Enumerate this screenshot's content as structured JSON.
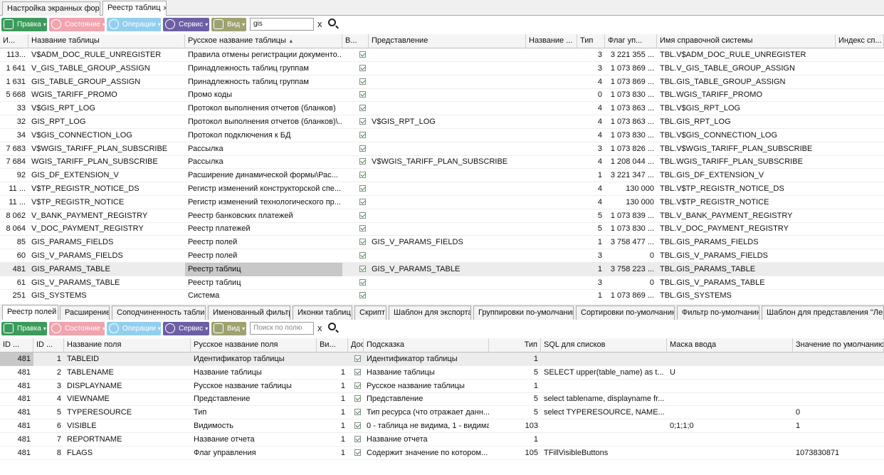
{
  "doc_tabs": [
    {
      "label": "Настройка экранных форм"
    },
    {
      "label": "Реестр таблиц",
      "close": "x"
    }
  ],
  "toolbar1": {
    "edit": "Правка",
    "state": "Состояние",
    "ops": "Операции",
    "service": "Сервис",
    "view": "Вид",
    "search_value": "gis",
    "clear": "x"
  },
  "top_grid": {
    "columns": [
      "И...",
      "Название таблицы",
      "Русское название таблицы",
      "В...",
      "Представление",
      "Название ...",
      "Тип",
      "Флаг уп...",
      "Имя справочной системы",
      "Индекс сп..."
    ],
    "rows": [
      {
        "id": "113...",
        "name": "V$ADM_DOC_RULE_UNREGISTER",
        "rus": "Правила отмены регистрации документо...",
        "view": "",
        "type": "3",
        "flag": "3 221 355 ...",
        "ref": "TBL.V$ADM_DOC_RULE_UNREGISTER"
      },
      {
        "id": "1 641",
        "name": "V_GIS_TABLE_GROUP_ASSIGN",
        "rus": "Принадлежность таблиц группам",
        "view": "",
        "type": "3",
        "flag": "1 073 869 ...",
        "ref": "TBL.V_GIS_TABLE_GROUP_ASSIGN"
      },
      {
        "id": "1 631",
        "name": "GIS_TABLE_GROUP_ASSIGN",
        "rus": "Принадлежность таблиц группам",
        "view": "",
        "type": "4",
        "flag": "1 073 869 ...",
        "ref": "TBL.GIS_TABLE_GROUP_ASSIGN"
      },
      {
        "id": "5 668",
        "name": "WGIS_TARIFF_PROMO",
        "rus": "Промо коды",
        "view": "",
        "type": "0",
        "flag": "1 073 830 ...",
        "ref": "TBL.WGIS_TARIFF_PROMO"
      },
      {
        "id": "33",
        "name": "V$GIS_RPT_LOG",
        "rus": "Протокол выполнения отчетов (бланков)",
        "view": "",
        "type": "4",
        "flag": "1 073 863 ...",
        "ref": "TBL.V$GIS_RPT_LOG"
      },
      {
        "id": "32",
        "name": "GIS_RPT_LOG",
        "rus": "Протокол выполнения отчетов (бланков)\\...",
        "view": "V$GIS_RPT_LOG",
        "type": "4",
        "flag": "1 073 863 ...",
        "ref": "TBL.GIS_RPT_LOG"
      },
      {
        "id": "34",
        "name": "V$GIS_CONNECTION_LOG",
        "rus": "Протокол подключения к БД",
        "view": "",
        "type": "4",
        "flag": "1 073 830 ...",
        "ref": "TBL.V$GIS_CONNECTION_LOG"
      },
      {
        "id": "7 683",
        "name": "V$WGIS_TARIFF_PLAN_SUBSCRIBE",
        "rus": "Рассылка",
        "view": "",
        "type": "3",
        "flag": "1 073 826 ...",
        "ref": "TBL.V$WGIS_TARIFF_PLAN_SUBSCRIBE"
      },
      {
        "id": "7 684",
        "name": "WGIS_TARIFF_PLAN_SUBSCRIBE",
        "rus": "Рассылка",
        "view": "V$WGIS_TARIFF_PLAN_SUBSCRIBE",
        "type": "4",
        "flag": "1 208 044 ...",
        "ref": "TBL.WGIS_TARIFF_PLAN_SUBSCRIBE"
      },
      {
        "id": "92",
        "name": "GIS_DF_EXTENSION_V",
        "rus": "Расширение динамической формы\\Рас...",
        "view": "",
        "type": "1",
        "flag": "3 221 347 ...",
        "ref": "TBL.GIS_DF_EXTENSION_V"
      },
      {
        "id": "11 ...",
        "name": "V$TP_REGISTR_NOTICE_DS",
        "rus": "Регистр изменений конструкторской спе...",
        "view": "",
        "type": "4",
        "flag": "130 000",
        "ref": "TBL.V$TP_REGISTR_NOTICE_DS"
      },
      {
        "id": "11 ...",
        "name": "V$TP_REGISTR_NOTICE",
        "rus": "Регистр изменений технологического пр...",
        "view": "",
        "type": "4",
        "flag": "130 000",
        "ref": "TBL.V$TP_REGISTR_NOTICE"
      },
      {
        "id": "8 062",
        "name": "V_BANK_PAYMENT_REGISTRY",
        "rus": "Реестр банковских платежей",
        "view": "",
        "type": "5",
        "flag": "1 073 839 ...",
        "ref": "TBL.V_BANK_PAYMENT_REGISTRY"
      },
      {
        "id": "8 064",
        "name": "V_DOC_PAYMENT_REGISTRY",
        "rus": "Реестр платежей",
        "view": "",
        "type": "5",
        "flag": "1 073 830 ...",
        "ref": "TBL.V_DOC_PAYMENT_REGISTRY"
      },
      {
        "id": "85",
        "name": "GIS_PARAMS_FIELDS",
        "rus": "Реестр полей",
        "view": "GIS_V_PARAMS_FIELDS",
        "type": "1",
        "flag": "3 758 477 ...",
        "ref": "TBL.GIS_PARAMS_FIELDS"
      },
      {
        "id": "60",
        "name": "GIS_V_PARAMS_FIELDS",
        "rus": "Реестр полей",
        "view": "",
        "type": "3",
        "flag": "0",
        "ref": "TBL.GIS_V_PARAMS_FIELDS"
      },
      {
        "id": "481",
        "name": "GIS_PARAMS_TABLE",
        "rus": "Реестр таблиц",
        "view": "GIS_V_PARAMS_TABLE",
        "type": "1",
        "flag": "3 758 223 ...",
        "ref": "TBL.GIS_PARAMS_TABLE",
        "selected": true
      },
      {
        "id": "61",
        "name": "GIS_V_PARAMS_TABLE",
        "rus": "Реестр таблиц",
        "view": "",
        "type": "3",
        "flag": "0",
        "ref": "TBL.GIS_V_PARAMS_TABLE"
      },
      {
        "id": "251",
        "name": "GIS_SYSTEMS",
        "rus": "Система",
        "view": "",
        "type": "1",
        "flag": "1 073 869 ...",
        "ref": "TBL.GIS_SYSTEMS"
      }
    ]
  },
  "detail_tabs": [
    "Реестр полей",
    "Расширение",
    "Соподчиненность таблиц",
    "Именованный фильтр",
    "Иконки таблиц",
    "Скрипт",
    "Шаблон для экспорта",
    "Группировки по-умолчанию",
    "Сортировки по-умолчанию",
    "Фильтр по-умолчанию",
    "Шаблон для представления \"Лента\""
  ],
  "toolbar2": {
    "edit": "Правка",
    "state": "Состояние",
    "ops": "Операции",
    "service": "Сервис",
    "view": "Вид",
    "search_placeholder": "Поиск по полю",
    "clear": "x"
  },
  "bottom_grid": {
    "columns": [
      "ID ...",
      "ID ...",
      "Название поля",
      "Русское название поля",
      "Ви...",
      "Дос",
      "Подсказка",
      "Тип",
      "SQL для списков",
      "Маска ввода",
      "Значение по умолчанию"
    ],
    "rows": [
      {
        "tid": "481",
        "fid": "1",
        "name": "TABLEID",
        "rus": "Идентификатор таблицы",
        "vis": "",
        "hint": "Идентификатор таблицы",
        "type": "1",
        "sql": "",
        "mask": "",
        "def": "",
        "selected": true
      },
      {
        "tid": "481",
        "fid": "2",
        "name": "TABLENAME",
        "rus": "Название таблицы",
        "vis": "1",
        "hint": "Название таблицы",
        "type": "5",
        "sql": "SELECT upper(table_name) as t...",
        "mask": "U",
        "def": ""
      },
      {
        "tid": "481",
        "fid": "3",
        "name": "DISPLAYNAME",
        "rus": "Русское название таблицы",
        "vis": "1",
        "hint": "Русское название таблицы",
        "type": "1",
        "sql": "",
        "mask": "",
        "def": ""
      },
      {
        "tid": "481",
        "fid": "4",
        "name": "VIEWNAME",
        "rus": "Представление",
        "vis": "1",
        "hint": "Представление",
        "type": "5",
        "sql": "select tablename, displayname fr...",
        "mask": "",
        "def": ""
      },
      {
        "tid": "481",
        "fid": "5",
        "name": "TYPERESOURCE",
        "rus": "Тип",
        "vis": "1",
        "hint": "Тип ресурса (что отражает данн...",
        "type": "5",
        "sql": "select TYPERESOURCE, NAME...",
        "mask": "",
        "def": "0"
      },
      {
        "tid": "481",
        "fid": "6",
        "name": "VISIBLE",
        "rus": "Видимость",
        "vis": "1",
        "hint": "0 - таблица не видима, 1 - видима",
        "type": "103",
        "sql": "",
        "mask": "0;1;1;0",
        "def": "1"
      },
      {
        "tid": "481",
        "fid": "7",
        "name": "REPORTNAME",
        "rus": "Название отчета",
        "vis": "1",
        "hint": "Название отчета",
        "type": "1",
        "sql": "",
        "mask": "",
        "def": ""
      },
      {
        "tid": "481",
        "fid": "8",
        "name": "FLAGS",
        "rus": "Флаг управления",
        "vis": "1",
        "hint": "Содержит значение по котором...",
        "type": "105",
        "sql": "TFillVisibleButtons",
        "mask": "",
        "def": "1073830871"
      }
    ]
  }
}
